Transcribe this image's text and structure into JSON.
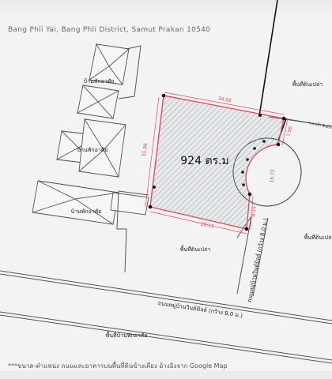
{
  "header": {
    "address": "Bang Phli Yai, Bang Phli District, Samut Prakan 10540"
  },
  "plot": {
    "area_label": "924 ตร.ม"
  },
  "dimensions": {
    "top": "34.68",
    "left": "31.96",
    "bottom": "28.15",
    "right_upper": "7.56",
    "right_curve": "16.72",
    "right_lower": "8.15"
  },
  "labels": {
    "house_1": "บ้านพักอาศัย",
    "house_2": "บ้านพักอาศัย",
    "house_3": "บ้านพักอาศัย",
    "vacant_north": "พื้นที่ดินเปล่า",
    "vacant_south": "พื้นที่ดินเปล่า",
    "vacant_east": "พื้นที่ดินเปล่า",
    "pond_note": "ระบายน้ำ\nพื้นที่น้ำ",
    "road_vertical": "ถนนหมู่บ้านวินด์มิลล์ (กว้าง 8.0 ม.)",
    "road_horizontal": "ถนนหมู่บ้านวินด์มิลล์ (กว้าง 8.0 ม.)",
    "residential_south": "พื้นที่บ้านพักอาศัย"
  },
  "footer": {
    "note": "***ขนาด-ตำแหน่ง ถนนและอาคารบนพื้นที่ดินข้างเคียง อ้างอิงจาก Google Map"
  },
  "colors": {
    "plot_boundary": "#e64a5a",
    "plot_hatch": "#9aa7b6",
    "lines": "#555555"
  }
}
